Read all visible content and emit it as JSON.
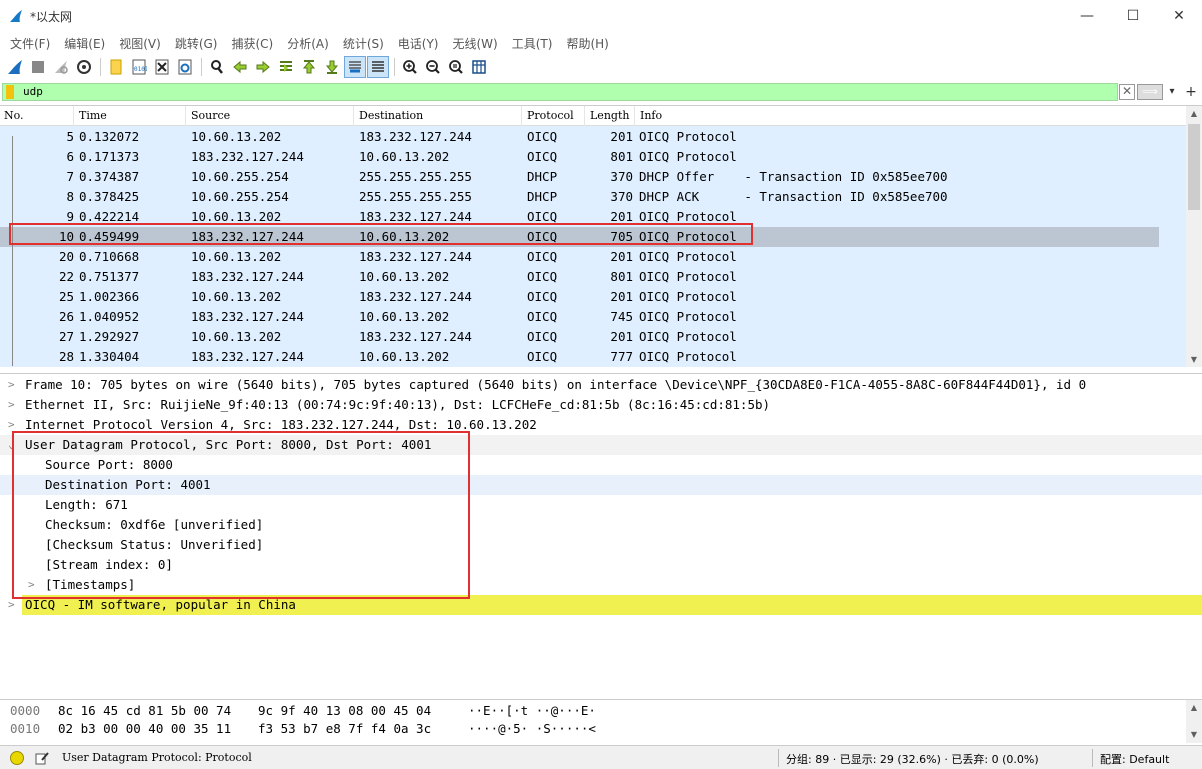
{
  "window": {
    "title": "*以太网",
    "minimize": "—",
    "maximize": "☐",
    "close": "✕"
  },
  "menu": [
    "文件(F)",
    "编辑(E)",
    "视图(V)",
    "跳转(G)",
    "捕获(C)",
    "分析(A)",
    "统计(S)",
    "电话(Y)",
    "无线(W)",
    "工具(T)",
    "帮助(H)"
  ],
  "toolbar": {
    "icons": [
      "start-capture-icon",
      "stop-capture-icon",
      "restart-capture-icon",
      "capture-options-icon",
      "open-file-icon",
      "save-file-icon",
      "close-file-icon",
      "reload-file-icon",
      "find-packet-icon",
      "go-back-icon",
      "go-forward-icon",
      "go-to-packet-icon",
      "go-first-icon",
      "go-last-icon",
      "auto-scroll-icon",
      "colorize-icon",
      "zoom-in-icon",
      "zoom-out-icon",
      "zoom-normal-icon",
      "resize-columns-icon"
    ]
  },
  "filter": {
    "value": "udp",
    "clear": "✕",
    "apply": "⟹",
    "dropdown": "▾",
    "add": "+",
    "bg_color": "#afffaf"
  },
  "packet_list": {
    "columns": [
      "No.",
      "Time",
      "Source",
      "Destination",
      "Protocol",
      "Length",
      "Info"
    ],
    "rows": [
      {
        "no": "5",
        "time": "0.132072",
        "src": "10.60.13.202",
        "dst": "183.232.127.244",
        "proto": "OICQ",
        "len": "201",
        "info": "OICQ Protocol"
      },
      {
        "no": "6",
        "time": "0.171373",
        "src": "183.232.127.244",
        "dst": "10.60.13.202",
        "proto": "OICQ",
        "len": "801",
        "info": "OICQ Protocol"
      },
      {
        "no": "7",
        "time": "0.374387",
        "src": "10.60.255.254",
        "dst": "255.255.255.255",
        "proto": "DHCP",
        "len": "370",
        "info": "DHCP Offer    - Transaction ID 0x585ee700"
      },
      {
        "no": "8",
        "time": "0.378425",
        "src": "10.60.255.254",
        "dst": "255.255.255.255",
        "proto": "DHCP",
        "len": "370",
        "info": "DHCP ACK      - Transaction ID 0x585ee700"
      },
      {
        "no": "9",
        "time": "0.422214",
        "src": "10.60.13.202",
        "dst": "183.232.127.244",
        "proto": "OICQ",
        "len": "201",
        "info": "OICQ Protocol"
      },
      {
        "no": "10",
        "time": "0.459499",
        "src": "183.232.127.244",
        "dst": "10.60.13.202",
        "proto": "OICQ",
        "len": "705",
        "info": "OICQ Protocol"
      },
      {
        "no": "20",
        "time": "0.710668",
        "src": "10.60.13.202",
        "dst": "183.232.127.244",
        "proto": "OICQ",
        "len": "201",
        "info": "OICQ Protocol"
      },
      {
        "no": "22",
        "time": "0.751377",
        "src": "183.232.127.244",
        "dst": "10.60.13.202",
        "proto": "OICQ",
        "len": "801",
        "info": "OICQ Protocol"
      },
      {
        "no": "25",
        "time": "1.002366",
        "src": "10.60.13.202",
        "dst": "183.232.127.244",
        "proto": "OICQ",
        "len": "201",
        "info": "OICQ Protocol"
      },
      {
        "no": "26",
        "time": "1.040952",
        "src": "183.232.127.244",
        "dst": "10.60.13.202",
        "proto": "OICQ",
        "len": "745",
        "info": "OICQ Protocol"
      },
      {
        "no": "27",
        "time": "1.292927",
        "src": "10.60.13.202",
        "dst": "183.232.127.244",
        "proto": "OICQ",
        "len": "201",
        "info": "OICQ Protocol"
      },
      {
        "no": "28",
        "time": "1.330404",
        "src": "183.232.127.244",
        "dst": "10.60.13.202",
        "proto": "OICQ",
        "len": "777",
        "info": "OICQ Protocol"
      }
    ],
    "selected_no": "10",
    "row_color": "#dfefff",
    "selected_color": "#bcc6d2"
  },
  "details": [
    {
      "text": "Frame 10: 705 bytes on wire (5640 bits), 705 bytes captured (5640 bits) on interface \\Device\\NPF_{30CDA8E0-F1CA-4055-8A8C-60F844F44D01}, id 0",
      "arrow": ">",
      "indent": 0
    },
    {
      "text": "Ethernet II, Src: RuijieNe_9f:40:13 (00:74:9c:9f:40:13), Dst: LCFCHeFe_cd:81:5b (8c:16:45:cd:81:5b)",
      "arrow": ">",
      "indent": 0
    },
    {
      "text": "Internet Protocol Version 4, Src: 183.232.127.244, Dst: 10.60.13.202",
      "arrow": ">",
      "indent": 0
    },
    {
      "text": "User Datagram Protocol, Src Port: 8000, Dst Port: 4001",
      "arrow": "⌄",
      "indent": 0
    },
    {
      "text": "Source Port: 8000",
      "arrow": "",
      "indent": 1
    },
    {
      "text": "Destination Port: 4001",
      "arrow": "",
      "indent": 1
    },
    {
      "text": "Length: 671",
      "arrow": "",
      "indent": 1
    },
    {
      "text": "Checksum: 0xdf6e [unverified]",
      "arrow": "",
      "indent": 1
    },
    {
      "text": "[Checksum Status: Unverified]",
      "arrow": "",
      "indent": 1
    },
    {
      "text": "[Stream index: 0]",
      "arrow": "",
      "indent": 1
    },
    {
      "text": "[Timestamps]",
      "arrow": ">",
      "indent": 1
    },
    {
      "text": "OICQ - IM software, popular in China",
      "arrow": ">",
      "indent": 0
    }
  ],
  "hex": [
    {
      "offset": "0000",
      "b1": "8c 16 45 cd 81 5b 00 74",
      "b2": "9c 9f 40 13 08 00 45 04",
      "ascii": "··E··[·t ··@···E·"
    },
    {
      "offset": "0010",
      "b1": "02 b3 00 00 40 00 35 11",
      "b2": "f3 53 b7 e8 7f f4 0a 3c",
      "ascii": "····@·5· ·S·····<"
    }
  ],
  "status": {
    "field": "User Datagram Protocol: Protocol",
    "stats": "分组: 89 · 已显示: 29 (32.6%) · 已丢弃: 0 (0.0%)",
    "profile": "配置: Default"
  }
}
